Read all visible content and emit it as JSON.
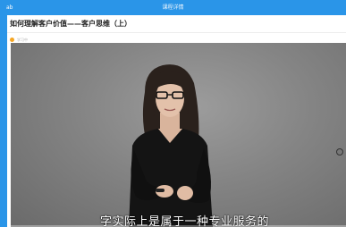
{
  "window": {
    "title": "课程详情",
    "left_label": "ab"
  },
  "course": {
    "title": "如何理解客户价值——客户思维（上）",
    "meta": "学习中"
  },
  "video": {
    "subtitle": "字实际上是属于一种专业服务的",
    "progress": 0.0
  },
  "colors": {
    "topbar": "#2a95e8",
    "meta_dot": "#f5a623"
  }
}
